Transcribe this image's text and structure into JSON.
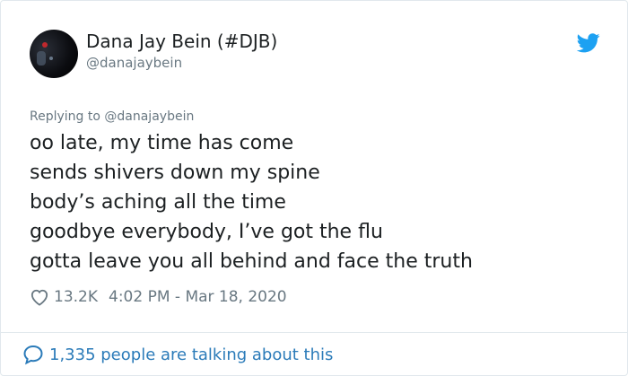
{
  "author": {
    "name": "Dana Jay Bein (#DJB)",
    "handle": "@danajaybein"
  },
  "reply": {
    "prefix": "Replying to ",
    "handle": "@danajaybein"
  },
  "tweet": {
    "lines": [
      "oo late, my time has come",
      "sends shivers down my spine",
      "body’s aching all the time",
      "goodbye everybody, I’ve got the flu",
      "gotta leave you all behind and face the truth"
    ]
  },
  "meta": {
    "likes": "13.2K",
    "timestamp": "4:02 PM - Mar 18, 2020"
  },
  "footer": {
    "talking": "1,335 people are talking about this"
  },
  "icons": {
    "bird": "twitter-bird-icon",
    "heart": "heart-icon",
    "bubble": "speech-bubble-icon"
  },
  "colors": {
    "twitter_blue": "#1da1f2",
    "link_blue": "#2b7bb9",
    "muted": "#697882",
    "text": "#1c2022",
    "border": "#e1e8ed"
  }
}
